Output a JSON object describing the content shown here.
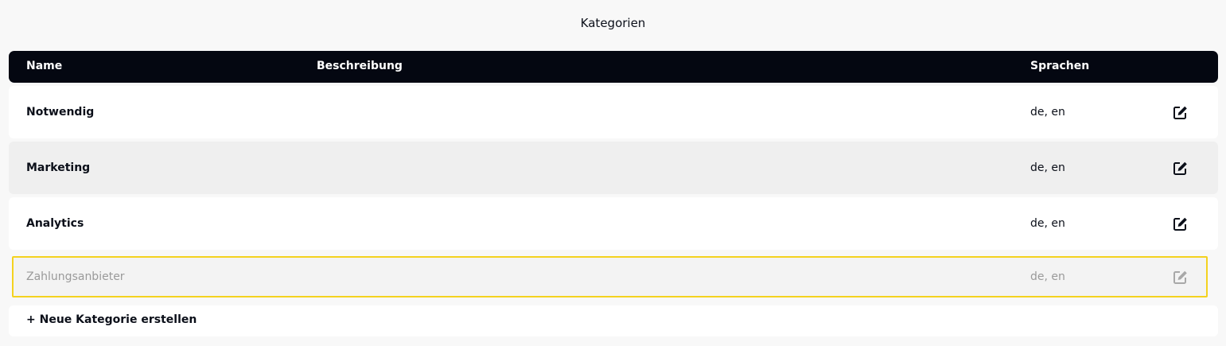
{
  "page": {
    "title": "Kategorien"
  },
  "table": {
    "headers": {
      "name": "Name",
      "description": "Beschreibung",
      "languages": "Sprachen"
    },
    "rows": [
      {
        "name": "Notwendig",
        "description": "",
        "languages": "de, en"
      },
      {
        "name": "Marketing",
        "description": "",
        "languages": "de, en"
      },
      {
        "name": "Analytics",
        "description": "",
        "languages": "de, en"
      },
      {
        "name": "Zahlungsanbieter",
        "description": "",
        "languages": "de, en"
      }
    ],
    "add_label": "+ Neue Kategorie erstellen"
  },
  "icons": {
    "edit": "edit-icon"
  },
  "colors": {
    "header_bg": "#040711",
    "selected_border": "#f4d21f",
    "row_alt_bg": "#efefef"
  }
}
